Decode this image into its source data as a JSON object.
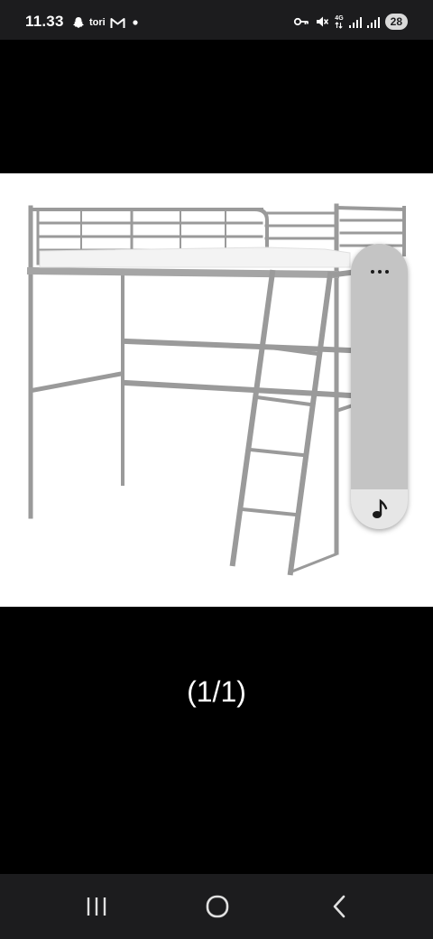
{
  "status_bar": {
    "time": "11.33",
    "app_label": "tori",
    "battery": "28",
    "left_icons": [
      "snapchat-icon",
      "gmail-icon",
      "notification-dot-icon"
    ],
    "right_icons": [
      "vpn-key-icon",
      "mute-icon",
      "network-4g-icon",
      "signal-icon",
      "signal-icon",
      "battery-icon"
    ],
    "network_label_top": "4G"
  },
  "viewer": {
    "image_subject": "loft-bed",
    "image_counter": "(1/1)"
  },
  "floating_pill": {
    "icons": [
      "more-options-icon",
      "music-note-icon"
    ]
  },
  "nav_bar": {
    "icons": [
      "recent-apps-icon",
      "home-icon",
      "back-icon"
    ]
  },
  "colors": {
    "background": "#000000",
    "status_bar": "#1c1c1e",
    "nav_bar": "#1c1c1e",
    "image_background": "#ffffff",
    "bed_metal": "#9a9a9a",
    "pill": "#c4c4c4"
  }
}
